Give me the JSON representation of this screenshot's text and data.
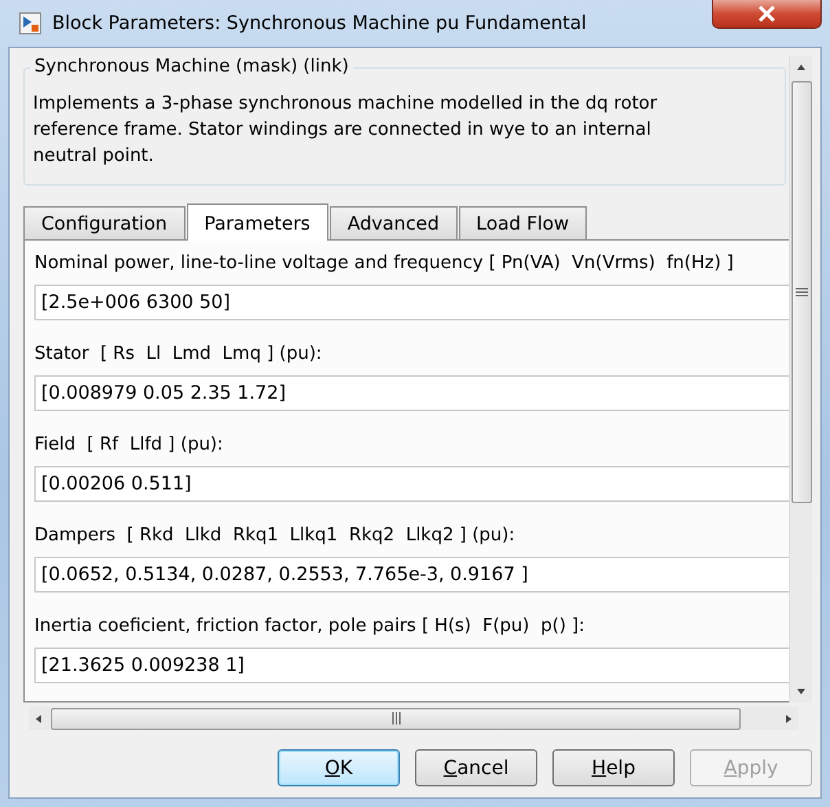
{
  "window": {
    "title": "Block Parameters: Synchronous Machine pu Fundamental"
  },
  "mask": {
    "title": "Synchronous Machine (mask) (link)",
    "description": "Implements a 3-phase synchronous machine modelled in the dq rotor reference frame. Stator windings are connected in wye to an internal neutral point."
  },
  "tabs": [
    {
      "label": "Configuration",
      "selected": false
    },
    {
      "label": "Parameters",
      "selected": true
    },
    {
      "label": "Advanced",
      "selected": false
    },
    {
      "label": "Load Flow",
      "selected": false
    }
  ],
  "parameters": [
    {
      "label": "Nominal power, line-to-line voltage and frequency [ Pn(VA)  Vn(Vrms)  fn(Hz) ]",
      "value": "[2.5e+006 6300 50]"
    },
    {
      "label": "Stator  [ Rs  Ll  Lmd  Lmq ] (pu):",
      "value": "[0.008979 0.05 2.35 1.72]"
    },
    {
      "label": "Field  [ Rf  Llfd ] (pu):",
      "value": "[0.00206 0.511]"
    },
    {
      "label": "Dampers  [ Rkd  Llkd  Rkq1  Llkq1  Rkq2  Llkq2 ] (pu):",
      "value": "[0.0652, 0.5134, 0.0287, 0.2553, 7.765e-3, 0.9167 ]"
    },
    {
      "label": "Inertia coeficient, friction factor, pole pairs [ H(s)  F(pu)  p() ]:",
      "value": "[21.3625 0.009238 1]"
    }
  ],
  "buttons": [
    {
      "label": "OK",
      "default": true,
      "disabled": false
    },
    {
      "label": "Cancel",
      "default": false,
      "disabled": false
    },
    {
      "label": "Help",
      "default": false,
      "disabled": false
    },
    {
      "label": "Apply",
      "default": false,
      "disabled": true
    }
  ]
}
